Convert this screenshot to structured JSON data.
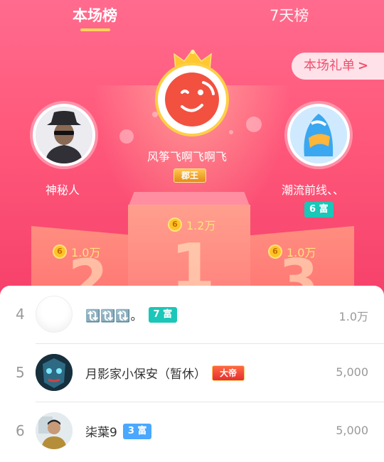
{
  "tabs": [
    {
      "label": "本场榜",
      "active": true
    },
    {
      "label": "7天榜",
      "active": false
    }
  ],
  "gift_button": {
    "label": "本场礼单",
    "chevron": "chevron-right-icon"
  },
  "podium": {
    "first": {
      "name": "风筝飞啊飞啊飞",
      "badge": "郡王",
      "amount": "1.2万",
      "rank_number": "1"
    },
    "second": {
      "name": "神秘人",
      "amount": "1.0万",
      "rank_number": "2"
    },
    "third": {
      "name": "潮流前线、、",
      "badge": "6 富",
      "amount": "1.0万",
      "rank_number": "3"
    }
  },
  "coin_icon": {
    "glyph": "6",
    "name": "coin-icon"
  },
  "list": [
    {
      "rank": "4",
      "name": "🔃🔃🔃。",
      "badge": "7 富",
      "value": "1.0万"
    },
    {
      "rank": "5",
      "name": "月影家小保安（暂休）",
      "badge": "大帝",
      "value": "5,000"
    },
    {
      "rank": "6",
      "name": "柒葉9",
      "badge": "3 富",
      "value": "5,000"
    }
  ],
  "colors": {
    "accent": "#ff5a7c",
    "gold": "#ffd35a",
    "teal_badge": "#1ac7b8",
    "blue_badge": "#4aa8ff"
  }
}
